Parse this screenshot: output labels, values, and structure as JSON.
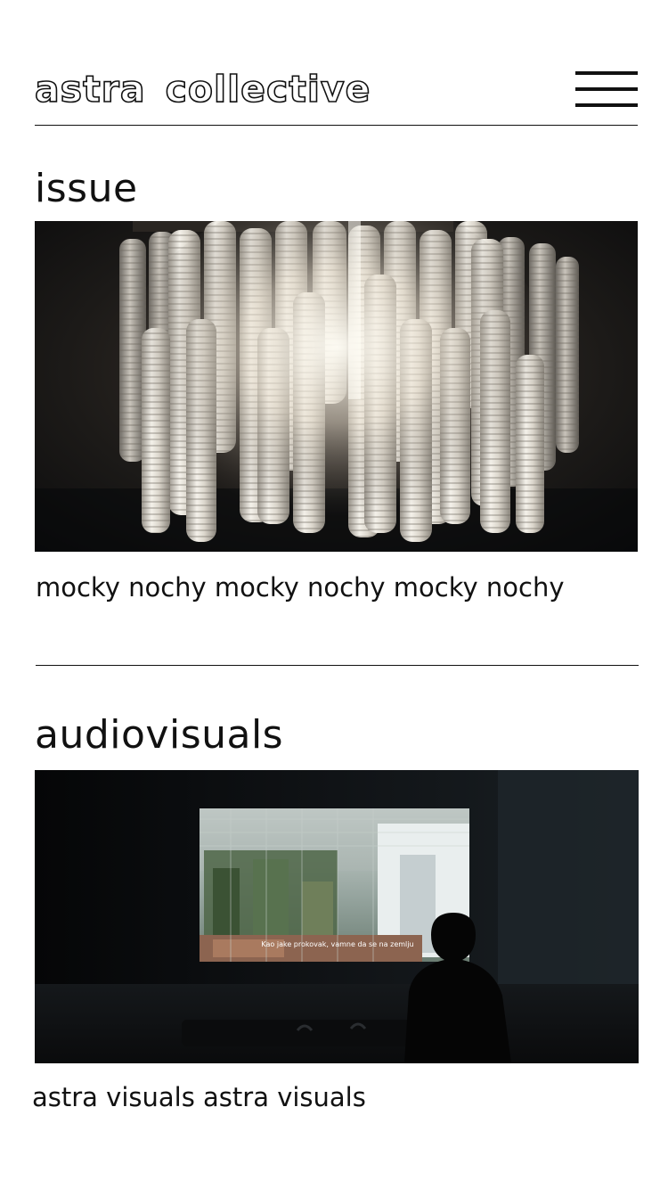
{
  "header": {
    "logo_word_1": "astra",
    "logo_word_2": "collective",
    "menu_icon": "hamburger-menu-icon"
  },
  "sections": [
    {
      "title": "issue",
      "image_subject": "photo of a glass-tube chandelier glowing warm white against a dark ceiling",
      "caption": "mocky nochy mocky nochy mocky nochy"
    },
    {
      "title": "audiovisuals",
      "image_subject": "photo of a dark screening room with a projected film of a construction site and a seated viewer in silhouette",
      "screen_subtitle": "Kao jake prokovak, vamne da se na zemlju",
      "caption": "astra visuals astra visuals"
    }
  ],
  "colors": {
    "text": "#111111",
    "background": "#ffffff",
    "rule": "#111111"
  }
}
